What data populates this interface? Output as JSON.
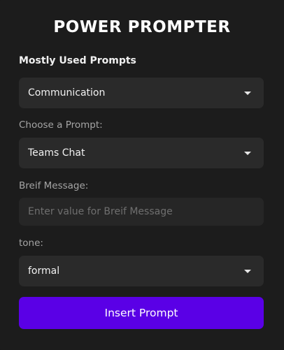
{
  "app": {
    "title": "POWER PROMPTER"
  },
  "mostly_used": {
    "label": "Mostly Used Prompts",
    "selected": "Communication"
  },
  "choose_prompt": {
    "label": "Choose a Prompt:",
    "selected": "Teams Chat"
  },
  "brief_message": {
    "label": "Breif Message:",
    "placeholder": "Enter value for Breif Message",
    "value": ""
  },
  "tone": {
    "label": "tone:",
    "selected": "formal"
  },
  "insert_button": {
    "label": "Insert Prompt"
  },
  "colors": {
    "background": "#1c1c1c",
    "field_background": "#2a2a2a",
    "accent": "#5a00e6"
  },
  "icons": {
    "dropdown": "chevron-down-icon"
  }
}
